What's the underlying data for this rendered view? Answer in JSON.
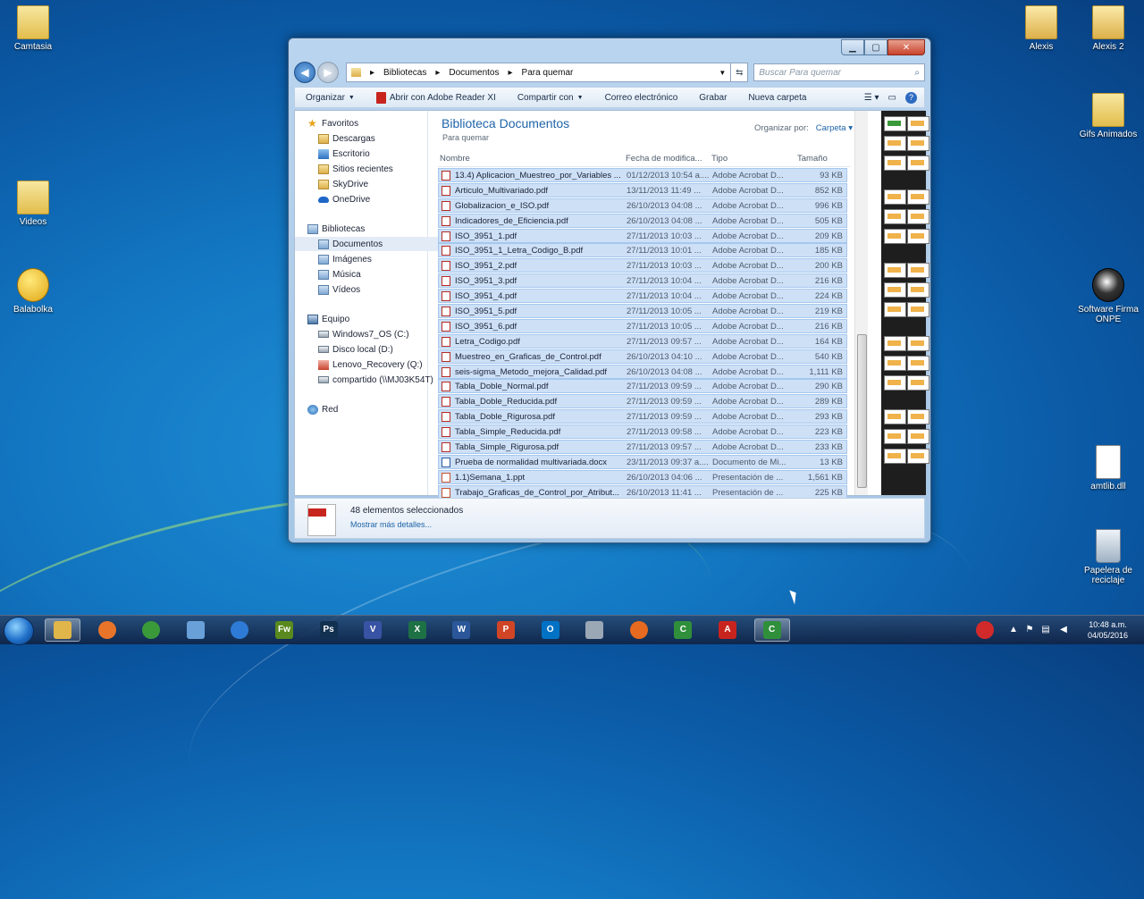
{
  "desktop": {
    "icons_left": [
      {
        "label": "Camtasia",
        "kind": "folder"
      },
      {
        "label": "Videos",
        "kind": "folder"
      },
      {
        "label": "Balabolka",
        "kind": "app"
      }
    ],
    "icons_right": [
      {
        "label": "Alexis",
        "kind": "folder-user"
      },
      {
        "label": "Alexis 2",
        "kind": "folder-user"
      },
      {
        "label": "Gifs Animados",
        "kind": "folder"
      },
      {
        "label": "Software Firma ONPE",
        "kind": "app"
      },
      {
        "label": "amtlib.dll",
        "kind": "file"
      },
      {
        "label": "Papelera de reciclaje",
        "kind": "recycle"
      }
    ]
  },
  "window": {
    "address": {
      "crumbs": [
        "Bibliotecas",
        "Documentos",
        "Para quemar"
      ]
    },
    "search": {
      "placeholder": "Buscar Para quemar"
    },
    "toolbar": {
      "organize": "Organizar",
      "open_with": "Abrir con Adobe Reader XI",
      "share": "Compartir con",
      "email": "Correo electrónico",
      "burn": "Grabar",
      "new_folder": "Nueva carpeta"
    },
    "nav": {
      "favorites": "Favoritos",
      "fav_items": [
        "Descargas",
        "Escritorio",
        "Sitios recientes",
        "SkyDrive",
        "OneDrive"
      ],
      "libraries": "Bibliotecas",
      "lib_items": [
        "Documentos",
        "Imágenes",
        "Música",
        "Vídeos"
      ],
      "computer": "Equipo",
      "comp_items": [
        "Windows7_OS (C:)",
        "Disco local (D:)",
        "Lenovo_Recovery (Q:)",
        "compartido (\\\\MJ03K54T)"
      ],
      "network": "Red"
    },
    "library": {
      "title": "Biblioteca Documentos",
      "subtitle": "Para quemar",
      "arrange_label": "Organizar por:",
      "arrange_value": "Carpeta"
    },
    "columns": {
      "name": "Nombre",
      "date": "Fecha de modifica...",
      "type": "Tipo",
      "size": "Tamaño"
    },
    "files": [
      {
        "name": "13.4) Aplicacion_Muestreo_por_Variables ...",
        "date": "01/12/2013 10:54 a....",
        "type": "Adobe Acrobat D...",
        "size": "93 KB",
        "kind": "pdf"
      },
      {
        "name": "Articulo_Multivariado.pdf",
        "date": "13/11/2013 11:49 ...",
        "type": "Adobe Acrobat D...",
        "size": "852 KB",
        "kind": "pdf"
      },
      {
        "name": "Globalizacion_e_ISO.pdf",
        "date": "26/10/2013 04:08 ...",
        "type": "Adobe Acrobat D...",
        "size": "996 KB",
        "kind": "pdf"
      },
      {
        "name": "Indicadores_de_Eficiencia.pdf",
        "date": "26/10/2013 04:08 ...",
        "type": "Adobe Acrobat D...",
        "size": "505 KB",
        "kind": "pdf"
      },
      {
        "name": "ISO_3951_1.pdf",
        "date": "27/11/2013 10:03 ...",
        "type": "Adobe Acrobat D...",
        "size": "209 KB",
        "kind": "pdf"
      },
      {
        "name": "ISO_3951_1_Letra_Codigo_B.pdf",
        "date": "27/11/2013 10:01 ...",
        "type": "Adobe Acrobat D...",
        "size": "185 KB",
        "kind": "pdf"
      },
      {
        "name": "ISO_3951_2.pdf",
        "date": "27/11/2013 10:03 ...",
        "type": "Adobe Acrobat D...",
        "size": "200 KB",
        "kind": "pdf"
      },
      {
        "name": "ISO_3951_3.pdf",
        "date": "27/11/2013 10:04 ...",
        "type": "Adobe Acrobat D...",
        "size": "216 KB",
        "kind": "pdf"
      },
      {
        "name": "ISO_3951_4.pdf",
        "date": "27/11/2013 10:04 ...",
        "type": "Adobe Acrobat D...",
        "size": "224 KB",
        "kind": "pdf"
      },
      {
        "name": "ISO_3951_5.pdf",
        "date": "27/11/2013 10:05 ...",
        "type": "Adobe Acrobat D...",
        "size": "219 KB",
        "kind": "pdf"
      },
      {
        "name": "ISO_3951_6.pdf",
        "date": "27/11/2013 10:05 ...",
        "type": "Adobe Acrobat D...",
        "size": "216 KB",
        "kind": "pdf"
      },
      {
        "name": "Letra_Codigo.pdf",
        "date": "27/11/2013 09:57 ...",
        "type": "Adobe Acrobat D...",
        "size": "164 KB",
        "kind": "pdf"
      },
      {
        "name": "Muestreo_en_Graficas_de_Control.pdf",
        "date": "26/10/2013 04:10 ...",
        "type": "Adobe Acrobat D...",
        "size": "540 KB",
        "kind": "pdf"
      },
      {
        "name": "seis-sigma_Metodo_mejora_Calidad.pdf",
        "date": "26/10/2013 04:08 ...",
        "type": "Adobe Acrobat D...",
        "size": "1,111 KB",
        "kind": "pdf"
      },
      {
        "name": "Tabla_Doble_Normal.pdf",
        "date": "27/11/2013 09:59 ...",
        "type": "Adobe Acrobat D...",
        "size": "290 KB",
        "kind": "pdf"
      },
      {
        "name": "Tabla_Doble_Reducida.pdf",
        "date": "27/11/2013 09:59 ...",
        "type": "Adobe Acrobat D...",
        "size": "289 KB",
        "kind": "pdf"
      },
      {
        "name": "Tabla_Doble_Rigurosa.pdf",
        "date": "27/11/2013 09:59 ...",
        "type": "Adobe Acrobat D...",
        "size": "293 KB",
        "kind": "pdf"
      },
      {
        "name": "Tabla_Simple_Reducida.pdf",
        "date": "27/11/2013 09:58 ...",
        "type": "Adobe Acrobat D...",
        "size": "223 KB",
        "kind": "pdf"
      },
      {
        "name": "Tabla_Simple_Rigurosa.pdf",
        "date": "27/11/2013 09:57 ...",
        "type": "Adobe Acrobat D...",
        "size": "233 KB",
        "kind": "pdf"
      },
      {
        "name": "Prueba de normalidad multivariada.docx",
        "date": "23/11/2013 09:37 a....",
        "type": "Documento de Mi...",
        "size": "13 KB",
        "kind": "docx"
      },
      {
        "name": "1.1)Semana_1.ppt",
        "date": "26/10/2013 04:06 ...",
        "type": "Presentación de ...",
        "size": "1,561 KB",
        "kind": "ppt"
      },
      {
        "name": "Trabajo_Graficas_de_Control_por_Atribut...",
        "date": "26/10/2013 11:41 ...",
        "type": "Presentación de ...",
        "size": "225 KB",
        "kind": "ppt"
      }
    ],
    "details": {
      "selected": "48 elementos seleccionados",
      "more": "Mostrar más detalles..."
    }
  },
  "taskbar": {
    "apps": [
      "explorer",
      "media-player",
      "chrome",
      "paint",
      "internet-explorer",
      "fireworks",
      "photoshop",
      "visio",
      "excel",
      "word",
      "powerpoint",
      "outlook",
      "app-misc",
      "firefox",
      "camtasia",
      "acrobat",
      "camtasia-recorder"
    ],
    "clock_time": "10:48 a.m.",
    "clock_date": "04/05/2016"
  },
  "colors": {
    "accent": "#1e64a8",
    "selection": "#cde0f6"
  }
}
